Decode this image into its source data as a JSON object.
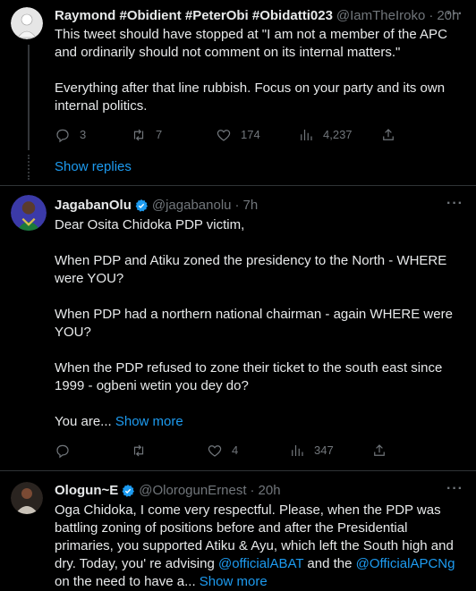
{
  "tweets": [
    {
      "name": "Raymond #Obidient #PeterObi #Obidatti023",
      "handle": "@IamTheIroko",
      "time": "20h",
      "verified": false,
      "paragraphs": [
        "This tweet should have stopped at \"I am not a member of the APC and ordinarily should not comment on its internal matters.\"",
        "Everything after that line rubbish. Focus on your party and its own internal politics."
      ],
      "counts": {
        "replies": "3",
        "retweets": "7",
        "likes": "174",
        "views": "4,237"
      }
    },
    {
      "name": "JagabanOlu",
      "handle": "@jagabanolu",
      "time": "7h",
      "verified": true,
      "paragraphs": [
        "Dear Osita Chidoka PDP victim,",
        "When PDP and Atiku zoned the presidency to the North - WHERE were YOU?",
        "When PDP had a northern national chairman - again WHERE were YOU?",
        "When the PDP refused to zone their ticket to the south east since 1999 - ogbeni wetin you dey do?",
        "You are..."
      ],
      "show_more": "Show more",
      "counts": {
        "replies": "",
        "retweets": "",
        "likes": "4",
        "views": "347"
      }
    },
    {
      "name": "Ologun~E",
      "handle": "@OlorogunErnest",
      "time": "20h",
      "verified": true,
      "text_part1": "Oga Chidoka, I come very respectful. Please, when the PDP was battling zoning of positions before and after the Presidential primaries, you supported Atiku & Ayu, which left the South high and dry. Today, you' re advising ",
      "mention1": "@officialABAT",
      "text_part2": " and the ",
      "mention2": "@OfficialAPCNg",
      "text_part3": " on the need to have a...",
      "show_more": "Show more"
    }
  ],
  "show_replies": "Show replies",
  "more_glyph": "···",
  "colors": {
    "background": "#000000",
    "text": "#e7e9ea",
    "muted": "#71767b",
    "accent": "#1d9bf0",
    "divider": "#2f3336"
  }
}
